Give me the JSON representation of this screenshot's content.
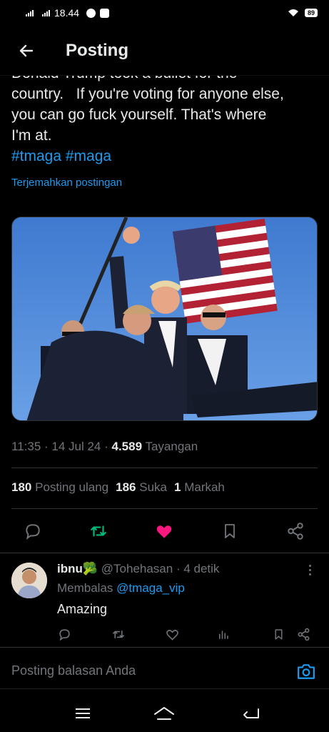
{
  "status_bar": {
    "time": "18.44",
    "battery": "89"
  },
  "header": {
    "title": "Posting"
  },
  "tweet": {
    "text_partial_top": "Donald Trump took a bullet for the",
    "text_lines": [
      "country.   If you're voting for anyone else,",
      "you can go fuck yourself. That's where",
      "I'm at."
    ],
    "hashtags": "#tmaga #maga",
    "translate_link": "Terjemahkan postingan",
    "time": "11:35",
    "date": "14 Jul 24",
    "views_count": "4.589",
    "views_label": "Tayangan",
    "reposts_count": "180",
    "reposts_label": "Posting ulang",
    "likes_count": "186",
    "likes_label": "Suka",
    "bookmarks_count": "1",
    "bookmarks_label": "Markah"
  },
  "actions": {
    "icons": [
      "reply-icon",
      "retweet-icon",
      "heart-icon",
      "bookmark-icon",
      "share-icon"
    ],
    "retweet_color": "#00ba7c",
    "like_color": "#f91880"
  },
  "reply": {
    "name": "ibnu🥦",
    "handle": "@Tohehasan",
    "time": "4 detik",
    "replying_label": "Membalas",
    "replying_to": "@tmaga_vip",
    "text": "Amazing"
  },
  "compose": {
    "placeholder": "Posting balasan Anda"
  },
  "colors": {
    "accent": "#1d9bf0",
    "background": "#000000",
    "muted": "#71767b"
  }
}
